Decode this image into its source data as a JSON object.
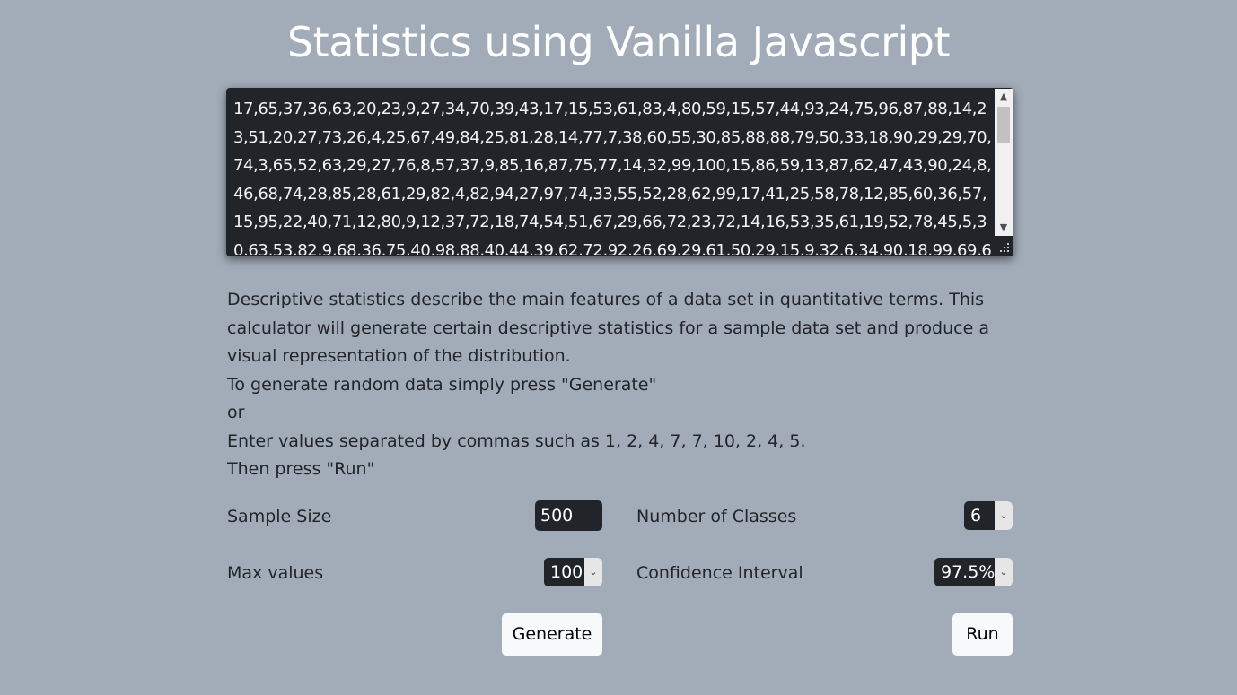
{
  "page": {
    "title": "Statistics using Vanilla Javascript"
  },
  "data_input": {
    "value": "17,65,37,36,63,20,23,9,27,34,70,39,43,17,15,53,61,83,4,80,59,15,57,44,93,24,75,96,87,88,14,23,51,20,27,73,26,4,25,67,49,84,25,81,28,14,77,7,38,60,55,30,85,88,88,79,50,33,18,90,29,29,70,74,3,65,52,63,29,27,76,8,57,37,9,85,16,87,75,77,14,32,99,100,15,86,59,13,87,62,47,43,90,24,8,46,68,74,28,85,28,61,29,82,4,82,94,27,97,74,33,55,52,28,62,99,17,41,25,58,78,12,85,60,36,57,15,95,22,40,71,12,80,9,12,37,72,18,74,54,51,67,29,66,72,23,72,14,16,53,35,61,19,52,78,45,5,30,63,53,82,9,68,36,75,40,98,88,40,44,39,62,72,92,26,69,29,61,50,29,15,9,32,6,34,90,18,99,69,6"
  },
  "description": {
    "line1": "Descriptive statistics describe the main features of a data set in quantitative terms. This calculator will generate certain descriptive statistics for a sample data set and produce a visual representation of the distribution.",
    "line2": "To generate random data simply press \"Generate\"",
    "line3": "or",
    "line4": "Enter values separated by commas such as 1, 2, 4, 7, 7, 10, 2, 4, 5.",
    "line5": "Then press \"Run\""
  },
  "controls": {
    "sample_size_label": "Sample Size",
    "sample_size_value": "500",
    "classes_label": "Number of Classes",
    "classes_value": "6",
    "max_values_label": "Max values",
    "max_values_value": "100",
    "confidence_label": "Confidence Interval",
    "confidence_value": "97.5%"
  },
  "buttons": {
    "generate": "Generate",
    "run": "Run"
  },
  "colors": {
    "background": "#a2acb8",
    "dark_field": "#212529",
    "button": "#f8f9fa"
  }
}
